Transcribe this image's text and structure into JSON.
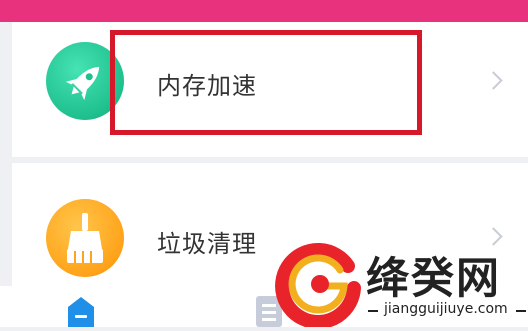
{
  "menu": {
    "items": [
      {
        "label": "内存加速",
        "icon": "rocket-icon",
        "color": "#1fbf8e"
      },
      {
        "label": "垃圾清理",
        "icon": "broom-icon",
        "color": "#ffa31a"
      }
    ]
  },
  "tabbar": {
    "tabs": [
      {
        "icon": "home-icon",
        "active": true,
        "color": "#1f8fe8"
      },
      {
        "icon": "list-icon",
        "active": false,
        "color": "#b9bfd0"
      }
    ]
  },
  "watermark": {
    "title": "绛癸网",
    "url": "jiangguijiuye.com"
  },
  "colors": {
    "accent_top": "#e8327e",
    "highlight_box": "#d6192a",
    "logo_red": "#e8232a",
    "logo_gold": "#f2b01e"
  }
}
